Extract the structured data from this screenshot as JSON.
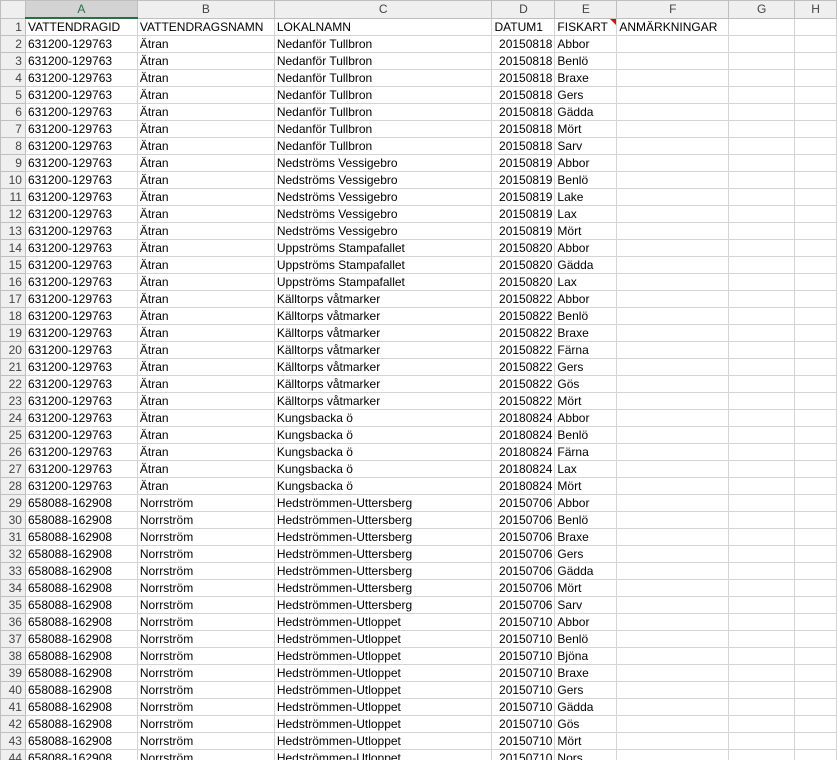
{
  "columns": [
    "A",
    "B",
    "C",
    "D",
    "E",
    "F",
    "G",
    "H"
  ],
  "headers": [
    "VATTENDRAGID",
    "VATTENDRAGSNAMN",
    "LOKALNAMN",
    "DATUM1",
    "FISKART",
    "ANMÄRKNINGAR",
    "",
    ""
  ],
  "rows": [
    [
      "631200-129763",
      "Ätran",
      "Nedanför Tullbron",
      "20150818",
      "Abbor"
    ],
    [
      "631200-129763",
      "Ätran",
      "Nedanför Tullbron",
      "20150818",
      "Benlö"
    ],
    [
      "631200-129763",
      "Ätran",
      "Nedanför Tullbron",
      "20150818",
      "Braxe"
    ],
    [
      "631200-129763",
      "Ätran",
      "Nedanför Tullbron",
      "20150818",
      "Gers"
    ],
    [
      "631200-129763",
      "Ätran",
      "Nedanför Tullbron",
      "20150818",
      "Gädda"
    ],
    [
      "631200-129763",
      "Ätran",
      "Nedanför Tullbron",
      "20150818",
      "Mört"
    ],
    [
      "631200-129763",
      "Ätran",
      "Nedanför Tullbron",
      "20150818",
      "Sarv"
    ],
    [
      "631200-129763",
      "Ätran",
      "Nedströms Vessigebro",
      "20150819",
      "Abbor"
    ],
    [
      "631200-129763",
      "Ätran",
      "Nedströms Vessigebro",
      "20150819",
      "Benlö"
    ],
    [
      "631200-129763",
      "Ätran",
      "Nedströms Vessigebro",
      "20150819",
      "Lake"
    ],
    [
      "631200-129763",
      "Ätran",
      "Nedströms Vessigebro",
      "20150819",
      "Lax"
    ],
    [
      "631200-129763",
      "Ätran",
      "Nedströms Vessigebro",
      "20150819",
      "Mört"
    ],
    [
      "631200-129763",
      "Ätran",
      "Uppströms Stampafallet",
      "20150820",
      "Abbor"
    ],
    [
      "631200-129763",
      "Ätran",
      "Uppströms Stampafallet",
      "20150820",
      "Gädda"
    ],
    [
      "631200-129763",
      "Ätran",
      "Uppströms Stampafallet",
      "20150820",
      "Lax"
    ],
    [
      "631200-129763",
      "Ätran",
      "Källtorps våtmarker",
      "20150822",
      "Abbor"
    ],
    [
      "631200-129763",
      "Ätran",
      "Källtorps våtmarker",
      "20150822",
      "Benlö"
    ],
    [
      "631200-129763",
      "Ätran",
      "Källtorps våtmarker",
      "20150822",
      "Braxe"
    ],
    [
      "631200-129763",
      "Ätran",
      "Källtorps våtmarker",
      "20150822",
      "Färna"
    ],
    [
      "631200-129763",
      "Ätran",
      "Källtorps våtmarker",
      "20150822",
      "Gers"
    ],
    [
      "631200-129763",
      "Ätran",
      "Källtorps våtmarker",
      "20150822",
      "Gös"
    ],
    [
      "631200-129763",
      "Ätran",
      "Källtorps våtmarker",
      "20150822",
      "Mört"
    ],
    [
      "631200-129763",
      "Ätran",
      "Kungsbacka ö",
      "20180824",
      "Abbor"
    ],
    [
      "631200-129763",
      "Ätran",
      "Kungsbacka ö",
      "20180824",
      "Benlö"
    ],
    [
      "631200-129763",
      "Ätran",
      "Kungsbacka ö",
      "20180824",
      "Färna"
    ],
    [
      "631200-129763",
      "Ätran",
      "Kungsbacka ö",
      "20180824",
      "Lax"
    ],
    [
      "631200-129763",
      "Ätran",
      "Kungsbacka ö",
      "20180824",
      "Mört"
    ],
    [
      "658088-162908",
      "Norrström",
      "Hedströmmen-Uttersberg",
      "20150706",
      "Abbor"
    ],
    [
      "658088-162908",
      "Norrström",
      "Hedströmmen-Uttersberg",
      "20150706",
      "Benlö"
    ],
    [
      "658088-162908",
      "Norrström",
      "Hedströmmen-Uttersberg",
      "20150706",
      "Braxe"
    ],
    [
      "658088-162908",
      "Norrström",
      "Hedströmmen-Uttersberg",
      "20150706",
      "Gers"
    ],
    [
      "658088-162908",
      "Norrström",
      "Hedströmmen-Uttersberg",
      "20150706",
      "Gädda"
    ],
    [
      "658088-162908",
      "Norrström",
      "Hedströmmen-Uttersberg",
      "20150706",
      "Mört"
    ],
    [
      "658088-162908",
      "Norrström",
      "Hedströmmen-Uttersberg",
      "20150706",
      "Sarv"
    ],
    [
      "658088-162908",
      "Norrström",
      "Hedströmmen-Utloppet",
      "20150710",
      "Abbor"
    ],
    [
      "658088-162908",
      "Norrström",
      "Hedströmmen-Utloppet",
      "20150710",
      "Benlö"
    ],
    [
      "658088-162908",
      "Norrström",
      "Hedströmmen-Utloppet",
      "20150710",
      "Bjöna"
    ],
    [
      "658088-162908",
      "Norrström",
      "Hedströmmen-Utloppet",
      "20150710",
      "Braxe"
    ],
    [
      "658088-162908",
      "Norrström",
      "Hedströmmen-Utloppet",
      "20150710",
      "Gers"
    ],
    [
      "658088-162908",
      "Norrström",
      "Hedströmmen-Utloppet",
      "20150710",
      "Gädda"
    ],
    [
      "658088-162908",
      "Norrström",
      "Hedströmmen-Utloppet",
      "20150710",
      "Gös"
    ],
    [
      "658088-162908",
      "Norrström",
      "Hedströmmen-Utloppet",
      "20150710",
      "Mört"
    ],
    [
      "658088-162908",
      "Norrström",
      "Hedströmmen-Utloppet",
      "20150710",
      "Nors"
    ]
  ]
}
